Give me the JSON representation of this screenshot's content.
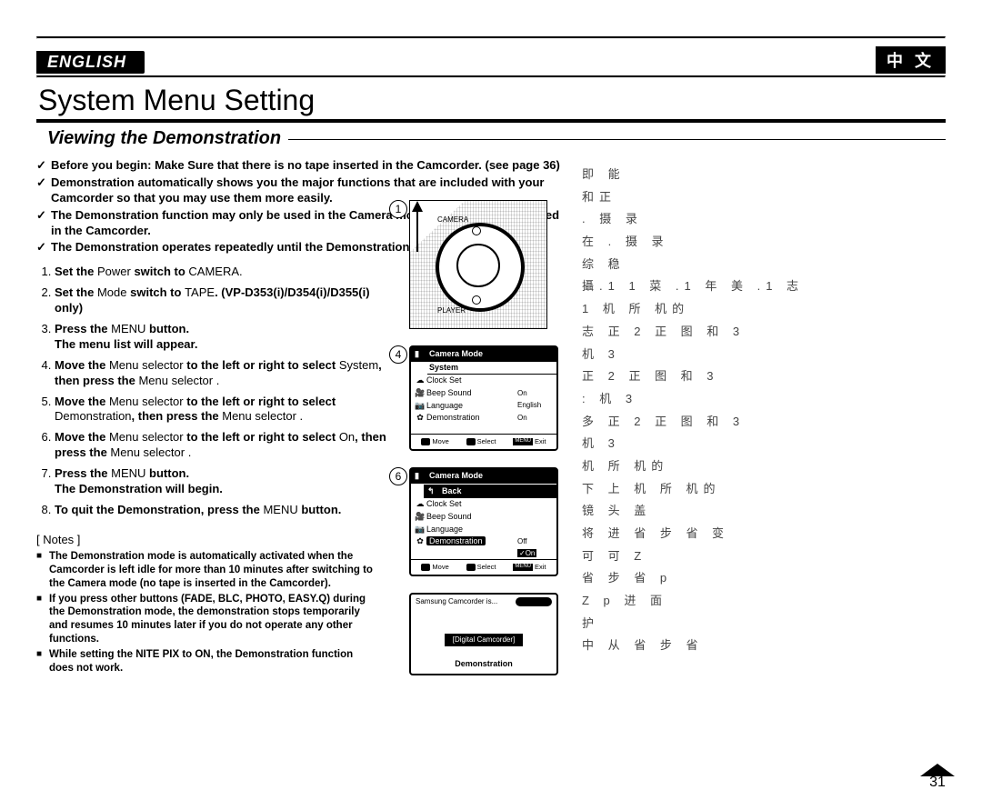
{
  "header": {
    "lang_en": "ENGLISH",
    "lang_cn": "中 文",
    "title": "System Menu Setting",
    "subtitle": "Viewing the Demonstration"
  },
  "intro_checks": [
    "Before you begin: Make Sure that there is no tape inserted in the Camcorder. (see page 36)",
    "Demonstration automatically shows you the major functions that are included with your Camcorder so that you may use them more easily.",
    "The Demonstration function may only be used in the Camera mode without a tape inserted in the Camcorder.",
    "The Demonstration operates repeatedly until the Demonstration mode switched Off."
  ],
  "steps": [
    {
      "pre": "Set the ",
      "a": "Power",
      "mid": " switch to ",
      "b": "CAMERA",
      "post": "."
    },
    {
      "pre": "Set the ",
      "a": "Mode",
      "mid": " switch to ",
      "b": "TAPE",
      "post": ". (VP-D353(i)/D354(i)/D355(i) only)"
    },
    {
      "pre": "Press the ",
      "a": "MENU",
      "mid": " button.",
      "b": "",
      "post": " The menu list will appear.",
      "post_bold": true
    },
    {
      "pre": "Move the ",
      "a": "Menu selector",
      "mid": " to the left or right to select ",
      "b": "System",
      "post": ", then press the Menu selector ."
    },
    {
      "pre": "Move the ",
      "a": "Menu selector",
      "mid": " to the left or right to select ",
      "b": "Demonstration",
      "post": ", then press the Menu selector ."
    },
    {
      "pre": "Move the ",
      "a": "Menu selector",
      "mid": " to the left or right to select ",
      "b": "On",
      "post": ", then press the Menu selector ."
    },
    {
      "pre": "Press the ",
      "a": "MENU",
      "mid": " button.",
      "b": "",
      "post": " The Demonstration will begin.",
      "post_bold": true
    },
    {
      "pre": "To quit the Demonstration, press the ",
      "a": "MENU",
      "mid": " button.",
      "b": "",
      "post": ""
    }
  ],
  "notes_title": "[ Notes ]",
  "notes": [
    "The Demonstration mode is automatically activated when the Camcorder is left idle for more than 10 minutes after switching to the Camera mode (no tape is inserted in the Camcorder).",
    "If you press other buttons (FADE, BLC, PHOTO, EASY.Q) during the Demonstration mode, the demonstration stops temporarily and resumes 10 minutes later if you do not operate any other functions.",
    "While setting the NITE PIX to ON, the Demonstration function does not work."
  ],
  "fig_numbers": {
    "dial": "1",
    "menu1": "4",
    "menu2": "6"
  },
  "dial": {
    "camera": "CAMERA",
    "player": "PLAYER"
  },
  "menu4": {
    "title": "Camera Mode",
    "section": "System",
    "rows": [
      {
        "icon": "☁",
        "label": "Clock Set",
        "val": ""
      },
      {
        "icon": "🎥",
        "label": "Beep Sound",
        "val": "On"
      },
      {
        "icon": "📷",
        "label": "Language",
        "val": "English"
      },
      {
        "icon": "✿",
        "label": "Demonstration",
        "val": "On"
      }
    ],
    "footer": {
      "move": "Move",
      "select": "Select",
      "exit": "Exit",
      "menu": "MENU"
    }
  },
  "menu6": {
    "title": "Camera Mode",
    "section": "Back",
    "rows": [
      {
        "icon": "☁",
        "label": "Clock Set",
        "val": ""
      },
      {
        "icon": "🎥",
        "label": "Beep Sound",
        "val": ""
      },
      {
        "icon": "📷",
        "label": "Language",
        "val": ""
      },
      {
        "icon": "✿",
        "label": "Demonstration",
        "val": "Off",
        "hl": true,
        "on": "On"
      }
    ],
    "footer": {
      "move": "Move",
      "select": "Select",
      "exit": "Exit",
      "menu": "MENU"
    }
  },
  "splash": {
    "top": "Samsung Camcorder is...",
    "btn": "[Digital Camcorder]",
    "label": "Demonstration"
  },
  "cn_lines": [
    "                                                              即 能",
    "和正",
    "                         .        摄 录",
    "                                  在                .         摄 录",
    "                         综       稳",
    "",
    "                         攝.1 1 菜    .1 年 美    .1    志",
    "1  机           所               机的",
    "志   正 2       正    图 和        3",
    "                                             机           3",
    "     正 2       正    图 和        3",
    "                           :                 机           3",
    "多   正 2       正    图 和        3",
    "                         机        3",
    "   机           所               机的",
    "",
    "下         上              机        所               机的",
    "镜 头 盖",
    "                将                进              省 步 省                    变",
    "     可  可                                                                   Z",
    "                         省 步 省                   p",
    "     Z                        p                进        面",
    "     护",
    "                中    从                                         省 步 省"
  ],
  "page_number": "31"
}
